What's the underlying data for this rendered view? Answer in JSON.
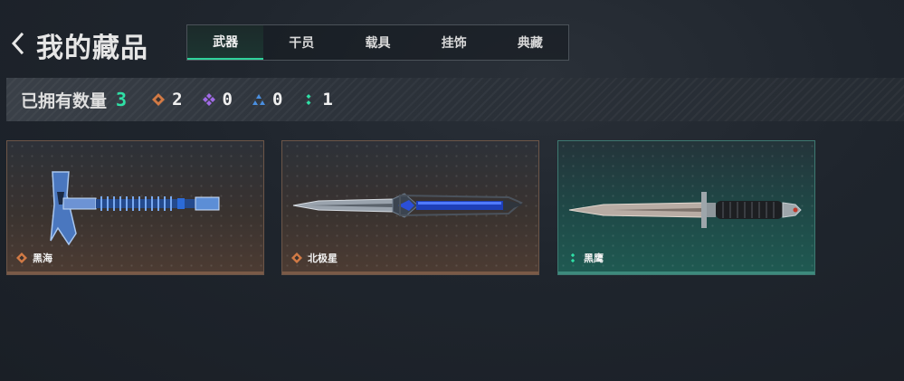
{
  "header": {
    "back_icon": "chevron-left-icon",
    "title": "我的藏品"
  },
  "tabs": [
    {
      "label": "武器",
      "active": true
    },
    {
      "label": "干员",
      "active": false
    },
    {
      "label": "载具",
      "active": false
    },
    {
      "label": "挂饰",
      "active": false
    },
    {
      "label": "典藏",
      "active": false
    }
  ],
  "stats": {
    "label": "已拥有数量",
    "total": "3",
    "rarities": [
      {
        "icon": "orange-diamond-icon",
        "color": "#d27a45",
        "count": "2"
      },
      {
        "icon": "purple-diamond-icon",
        "color": "#a06ae6",
        "count": "0"
      },
      {
        "icon": "blue-triangle-icon",
        "color": "#4a8fe0",
        "count": "0"
      },
      {
        "icon": "teal-dots-icon",
        "color": "#2fe0a6",
        "count": "1"
      }
    ]
  },
  "items": [
    {
      "name": "黑海",
      "rarity_icon": "orange-diamond-icon",
      "weapon": "tomahawk-axe"
    },
    {
      "name": "北极星",
      "rarity_icon": "orange-diamond-icon",
      "weapon": "blue-dagger"
    },
    {
      "name": "黑鹰",
      "rarity_icon": "teal-dots-icon",
      "weapon": "combat-knife"
    }
  ],
  "colors": {
    "accent": "#2fd29b",
    "orange": "#d27a45",
    "teal": "#2fe0a6"
  }
}
